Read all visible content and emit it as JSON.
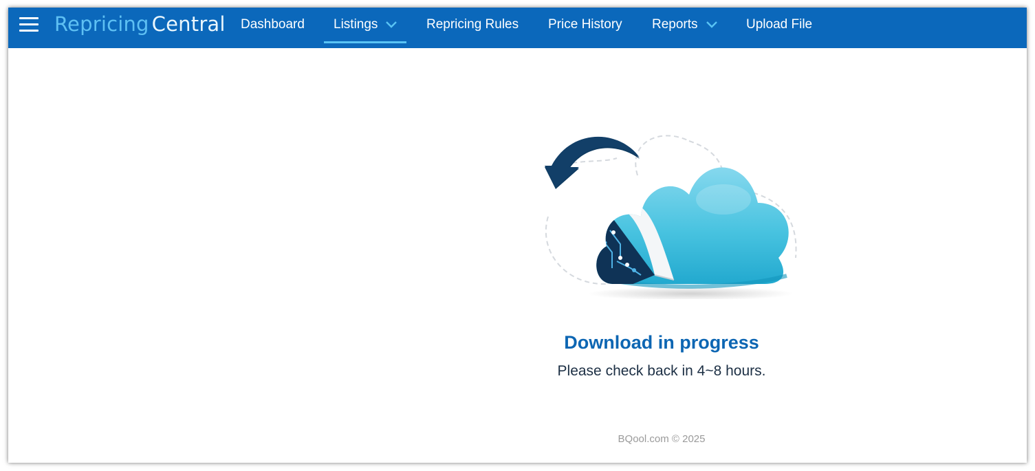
{
  "brand": {
    "part1": "Repricing",
    "part2": "Central"
  },
  "nav": {
    "dashboard": "Dashboard",
    "listings": "Listings",
    "repricing_rules": "Repricing Rules",
    "price_history": "Price History",
    "reports": "Reports",
    "upload_file": "Upload File"
  },
  "status": {
    "title": "Download in progress",
    "message": "Please check back in 4~8 hours."
  },
  "footer": {
    "copyright": "BQool.com © 2025"
  },
  "icons": {
    "menu": "hamburger-menu-icon",
    "dropdown": "chevron-down-icon",
    "illustration": "cloud-download-icon"
  },
  "colors": {
    "navbar": "#0b68bb",
    "active_underline": "#59c3f4",
    "title": "#0d66b3",
    "cloud": "#3fc0dc",
    "arrow": "#0f3b61"
  }
}
